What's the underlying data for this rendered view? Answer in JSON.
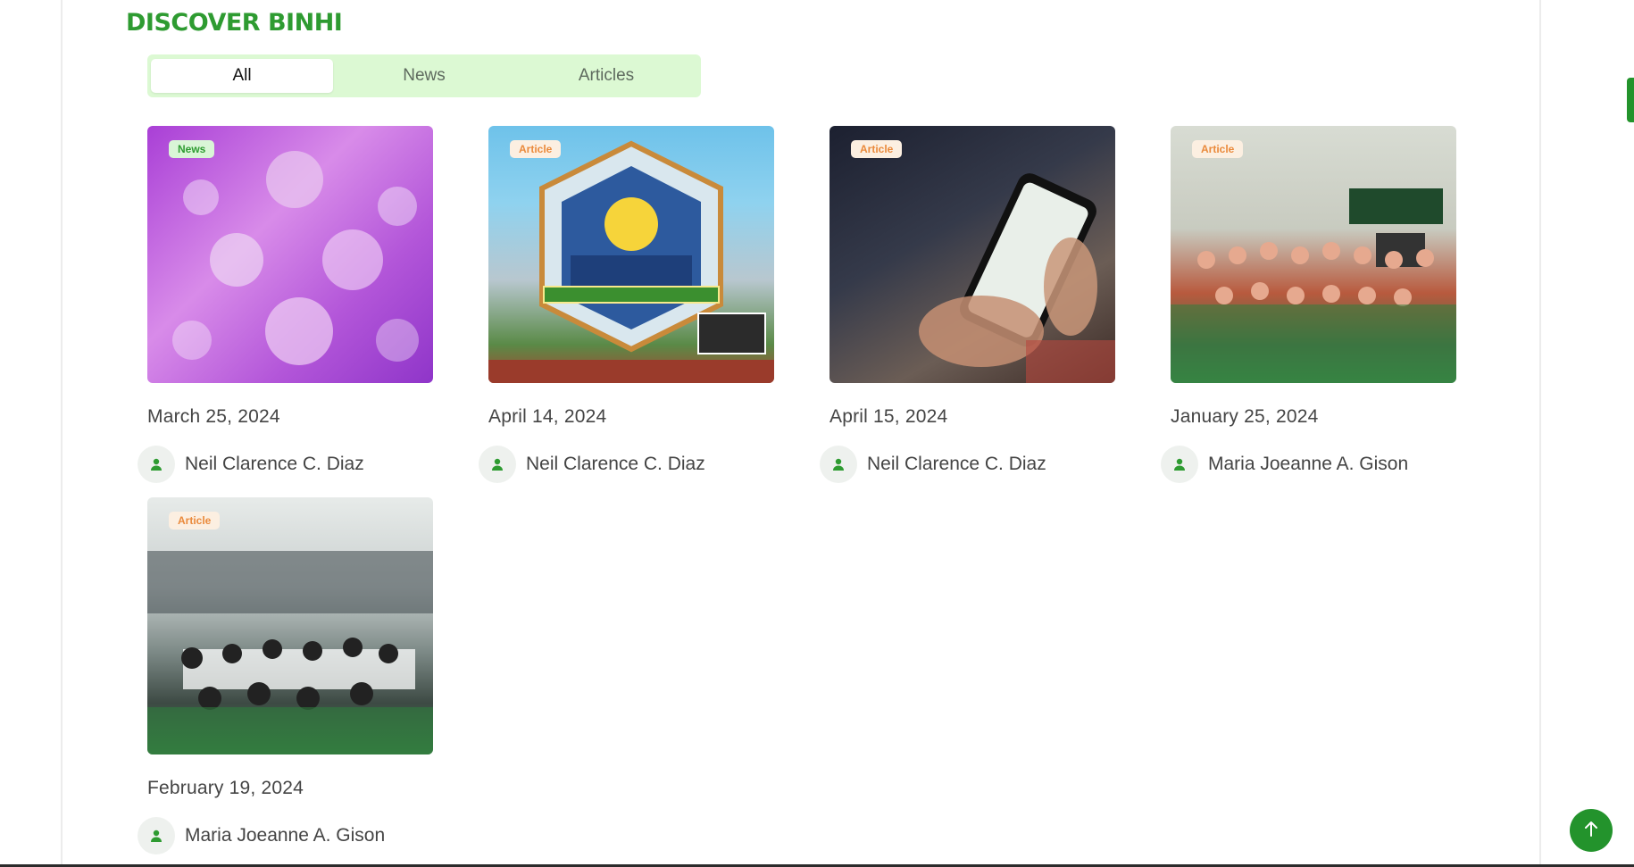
{
  "section": {
    "title": "DISCOVER BINHI"
  },
  "tabs": [
    {
      "label": "All",
      "active": true
    },
    {
      "label": "News",
      "active": false
    },
    {
      "label": "Articles",
      "active": false
    }
  ],
  "cards": [
    {
      "badge": "News",
      "date": "March 25, 2024",
      "author": "Neil Clarence C. Diaz"
    },
    {
      "badge": "Article",
      "date": "April 14, 2024",
      "author": "Neil Clarence C. Diaz"
    },
    {
      "badge": "Article",
      "date": "April 15, 2024",
      "author": "Neil Clarence C. Diaz"
    },
    {
      "badge": "Article",
      "date": "January 25, 2024",
      "author": "Maria Joeanne A. Gison"
    },
    {
      "badge": "Article",
      "date": "February 19, 2024",
      "author": "Maria Joeanne A. Gison"
    }
  ],
  "colors": {
    "brand": "#2e9b31",
    "badge_article": "#ea8a3c",
    "tabs_bg": "#dcf9d3"
  },
  "icons": {
    "author": "user-icon",
    "scroll": "arrow-up-icon"
  }
}
